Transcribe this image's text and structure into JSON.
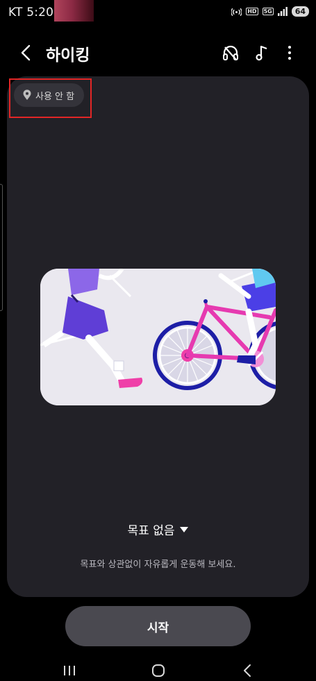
{
  "status_bar": {
    "carrier_time": "KT 5:20",
    "network": "5G",
    "hd_badge": "HD",
    "battery": "64"
  },
  "app_bar": {
    "title": "하이킹",
    "back_icon": "chevron-left-icon",
    "actions": [
      "headphones-icon",
      "music-note-icon",
      "more-vert-icon"
    ]
  },
  "card": {
    "location_chip": {
      "icon": "location-pin-icon",
      "label": "사용 안 함"
    },
    "goal": {
      "label": "목표 없음",
      "icon": "caret-down-icon"
    },
    "hint": "목표와 상관없이 자유롭게 운동해 보세요."
  },
  "start_button": {
    "label": "시작"
  },
  "nav_bar": {
    "items": [
      "recents-icon",
      "home-icon",
      "back-icon"
    ]
  },
  "colors": {
    "background": "#000000",
    "card": "#222127",
    "chip": "#34333a",
    "button": "#4a4950",
    "highlight": "#e32626"
  }
}
